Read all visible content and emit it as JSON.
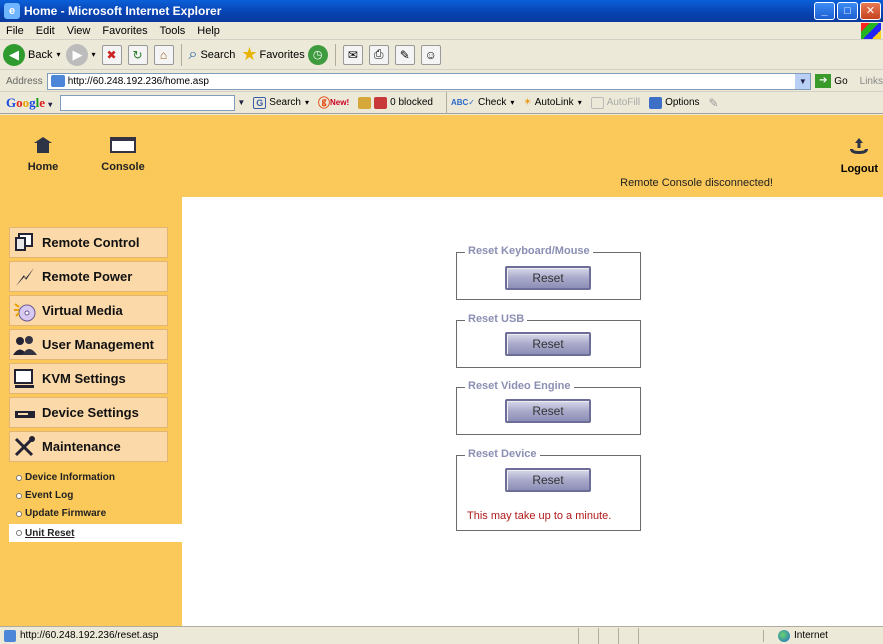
{
  "window": {
    "title": "Home - Microsoft Internet Explorer"
  },
  "menubar": {
    "items": [
      "File",
      "Edit",
      "View",
      "Favorites",
      "Tools",
      "Help"
    ]
  },
  "toolbar": {
    "back": "Back",
    "search": "Search",
    "favorites": "Favorites"
  },
  "address": {
    "label": "Address",
    "url": "http://60.248.192.236/home.asp",
    "go": "Go",
    "links": "Links"
  },
  "google": {
    "logo": "Google",
    "search": "Search",
    "new_badge": "New!",
    "blocked": "0 blocked",
    "check": "Check",
    "autolink": "AutoLink",
    "autofill": "AutoFill",
    "options": "Options"
  },
  "header": {
    "home_label": "Home",
    "console_label": "Console",
    "status_text": "Remote Console disconnected!",
    "logout_label": "Logout"
  },
  "sidebar": {
    "items": [
      {
        "label": "Remote Control",
        "icon": "remote-control-icon"
      },
      {
        "label": "Remote Power",
        "icon": "power-icon"
      },
      {
        "label": "Virtual Media",
        "icon": "disc-icon"
      },
      {
        "label": "User Management",
        "icon": "users-icon"
      },
      {
        "label": "KVM Settings",
        "icon": "monitor-icon"
      },
      {
        "label": "Device Settings",
        "icon": "device-icon"
      },
      {
        "label": "Maintenance",
        "icon": "tools-icon"
      }
    ],
    "subitems": [
      "Device Information",
      "Event Log",
      "Update Firmware",
      "Unit Reset"
    ]
  },
  "main": {
    "groups": [
      {
        "legend": "Reset Keyboard/Mouse",
        "button": "Reset"
      },
      {
        "legend": "Reset USB",
        "button": "Reset"
      },
      {
        "legend": "Reset Video Engine",
        "button": "Reset"
      },
      {
        "legend": "Reset Device",
        "button": "Reset",
        "note": "This may take up to a minute."
      }
    ]
  },
  "statusbar": {
    "url": "http://60.248.192.236/reset.asp",
    "zone": "Internet"
  },
  "colors": {
    "accent": "#fbc85a",
    "menu_button": "#fbd9a9",
    "legend": "#8b8fb3",
    "warning": "#b01919"
  }
}
